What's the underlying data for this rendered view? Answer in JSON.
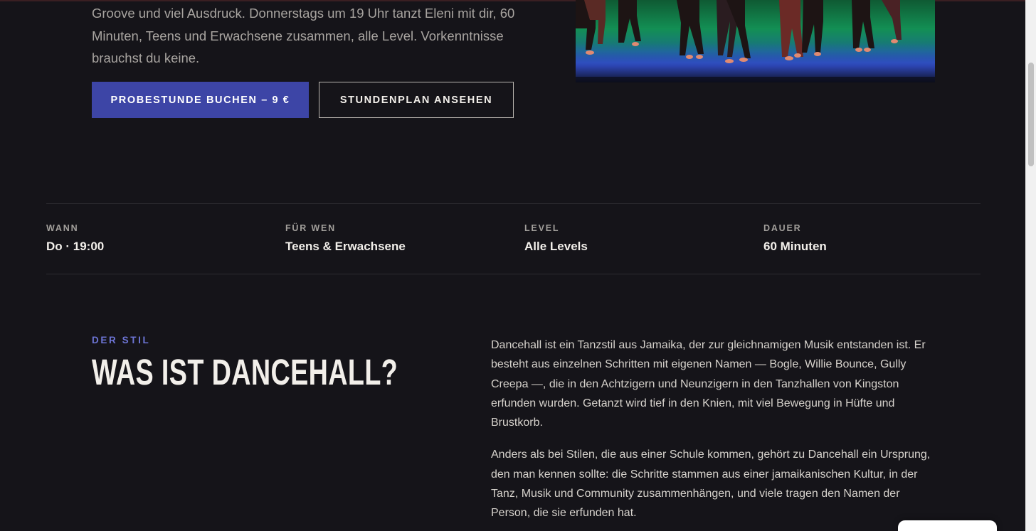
{
  "hero": {
    "text": "Groove und viel Ausdruck. Donnerstags um 19 Uhr tanzt Eleni mit dir, 60 Minuten, Teens und Erwachsene zusammen, alle Level. Vorkenntnisse brauchst du keine.",
    "primary_button": "PROBESTUNDE BUCHEN – 9 €",
    "secondary_button": "STUNDENPLAN ANSEHEN"
  },
  "facts": [
    {
      "label": "WANN",
      "value": "Do · 19:00"
    },
    {
      "label": "FÜR WEN",
      "value": "Teens & Erwachsene"
    },
    {
      "label": "LEVEL",
      "value": "Alle Levels"
    },
    {
      "label": "DAUER",
      "value": "60 Minuten"
    }
  ],
  "style_section": {
    "eyebrow": "DER STIL",
    "title": "WAS IST DANCEHALL?",
    "paragraphs": [
      "Dancehall ist ein Tanzstil aus Jamaika, der zur gleichnamigen Musik entstanden ist. Er besteht aus einzelnen Schritten mit eigenen Namen — Bogle, Willie Bounce, Gully Creepa —, die in den Achtzigern und Neunzigern in den Tanzhallen von Kingston erfunden wurden. Getanzt wird tief in den Knien, mit viel Bewegung in Hüfte und Brustkorb.",
      "Anders als bei Stilen, die aus einer Schule kommen, gehört zu Dancehall ein Ursprung, den man kennen sollte: die Schritte stammen aus einer jamaikanischen Kultur, in der Tanz, Musik und Community zusammenhängen, und viele tragen den Namen der Person, die sie erfunden hat."
    ]
  },
  "colors": {
    "background": "#151419",
    "accent": "#3d45a6",
    "eyebrow": "#6c74d4"
  }
}
